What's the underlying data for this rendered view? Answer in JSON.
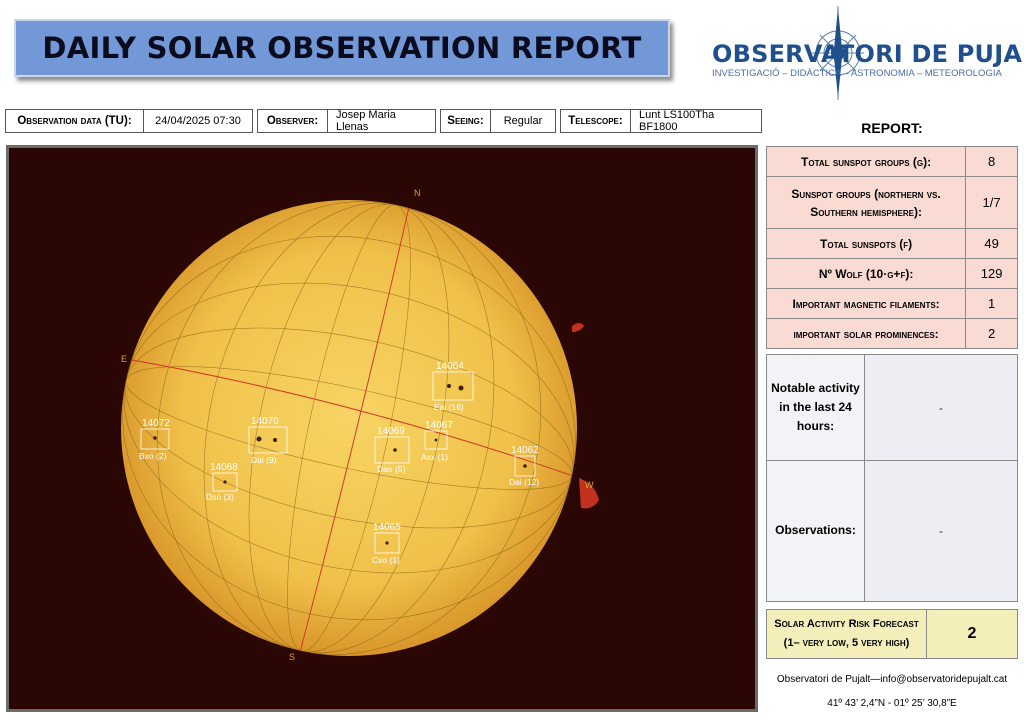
{
  "header": {
    "title": "DAILY SOLAR OBSERVATION REPORT"
  },
  "logo": {
    "name": "OBSERVATORI DE PUJALT",
    "tagline": "INVESTIGACIÓ – DIDÀCTICA – ASTRONOMIA – METEOROLOGIA"
  },
  "observation": {
    "date_label": "Observation data (TU):",
    "date_value": "24/04/2025 07:30",
    "observer_label": "Observer:",
    "observer_value": "Josep Maria Llenas",
    "seeing_label": "Seeing:",
    "seeing_value": "Regular",
    "telescope_label": "Telescope:",
    "telescope_value": "Lunt LS100Tha BF1800"
  },
  "sun": {
    "directions": {
      "north": "N",
      "south": "S",
      "east": "E",
      "west": "W"
    },
    "groups": [
      {
        "id": "14064",
        "class": "Eai (16)"
      },
      {
        "id": "14072",
        "class": "Bxo (2)"
      },
      {
        "id": "14070",
        "class": "Dai (9)"
      },
      {
        "id": "14069",
        "class": "Dao (5)"
      },
      {
        "id": "14067",
        "class": "Axx (1)"
      },
      {
        "id": "14062",
        "class": "Dai (12)"
      },
      {
        "id": "14068",
        "class": "Dso (3)"
      },
      {
        "id": "14065",
        "class": "Cso (1)"
      }
    ],
    "colors": {
      "disk": "#f2c54a",
      "background": "#2a0604",
      "grid": "#7a5a1a",
      "equator": "#d23a2a"
    }
  },
  "report": {
    "heading": "REPORT:",
    "rows": [
      {
        "label": "Total sunspot groups (g):",
        "value": "8"
      },
      {
        "label": "Sunspot groups (northern vs. Southern hemisphere):",
        "value": "1/7"
      },
      {
        "label": "Total sunspots (f)",
        "value": "49"
      },
      {
        "label": "Nº Wolf (10·g+f):",
        "value": "129"
      },
      {
        "label": "Important magnetic filaments:",
        "value": "1"
      },
      {
        "label": "important solar prominences:",
        "value": "2"
      }
    ]
  },
  "notes": {
    "activity_label": "Notable activity in the last 24 hours:",
    "activity_value": "-",
    "observations_label": "Observations:",
    "observations_value": "-"
  },
  "forecast": {
    "label_line1": "Solar Activity Risk Forecast",
    "label_line2": "(1– very low, 5 very high)",
    "value": "2"
  },
  "footer": {
    "contact": "Observatori de Pujalt—info@observatoridepujalt.cat",
    "coordinates": "41º 43’ 2,4”N - 01º 25’ 30,8”E"
  }
}
